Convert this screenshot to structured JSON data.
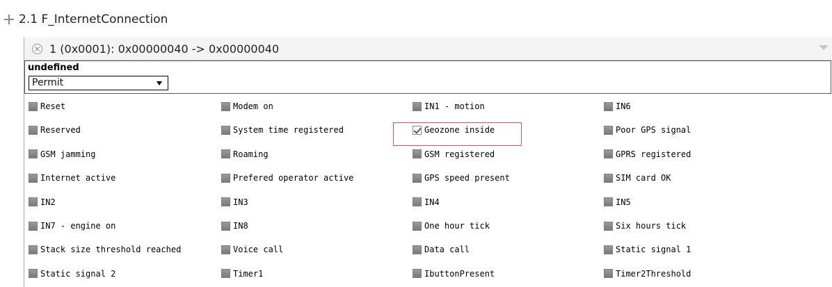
{
  "section": {
    "title": "2.1 F_InternetConnection"
  },
  "panel": {
    "header": "1 (0x0001): 0x00000040 -> 0x00000040",
    "subheader": "undefined",
    "select_value": "Permit"
  },
  "flags": [
    [
      {
        "label": "Reset",
        "checked": false
      },
      {
        "label": "Modem on",
        "checked": false
      },
      {
        "label": "IN1 - motion",
        "checked": false
      },
      {
        "label": "IN6",
        "checked": false
      }
    ],
    [
      {
        "label": "Reserved",
        "checked": false
      },
      {
        "label": "System time registered",
        "checked": false
      },
      {
        "label": "Geozone inside",
        "checked": true
      },
      {
        "label": "Poor GPS signal",
        "checked": false
      }
    ],
    [
      {
        "label": "GSM jamming",
        "checked": false
      },
      {
        "label": "Roaming",
        "checked": false
      },
      {
        "label": "GSM registered",
        "checked": false
      },
      {
        "label": "GPRS registered",
        "checked": false
      }
    ],
    [
      {
        "label": "Internet active",
        "checked": false
      },
      {
        "label": "Prefered operator active",
        "checked": false
      },
      {
        "label": "GPS speed present",
        "checked": false
      },
      {
        "label": "SIM card OK",
        "checked": false
      }
    ],
    [
      {
        "label": "IN2",
        "checked": false
      },
      {
        "label": "IN3",
        "checked": false
      },
      {
        "label": "IN4",
        "checked": false
      },
      {
        "label": "IN5",
        "checked": false
      }
    ],
    [
      {
        "label": "IN7 - engine on",
        "checked": false
      },
      {
        "label": "IN8",
        "checked": false
      },
      {
        "label": "One hour tick",
        "checked": false
      },
      {
        "label": "Six hours tick",
        "checked": false
      }
    ],
    [
      {
        "label": "Stack size threshold reached",
        "checked": false
      },
      {
        "label": "Voice call",
        "checked": false
      },
      {
        "label": "Data call",
        "checked": false
      },
      {
        "label": "Static signal 1",
        "checked": false
      }
    ],
    [
      {
        "label": "Static signal 2",
        "checked": false
      },
      {
        "label": "Timer1",
        "checked": false
      },
      {
        "label": "IbuttonPresent",
        "checked": false
      },
      {
        "label": "Timer2Threshold",
        "checked": false
      }
    ]
  ],
  "colors": {
    "highlight": "#e0457b"
  }
}
